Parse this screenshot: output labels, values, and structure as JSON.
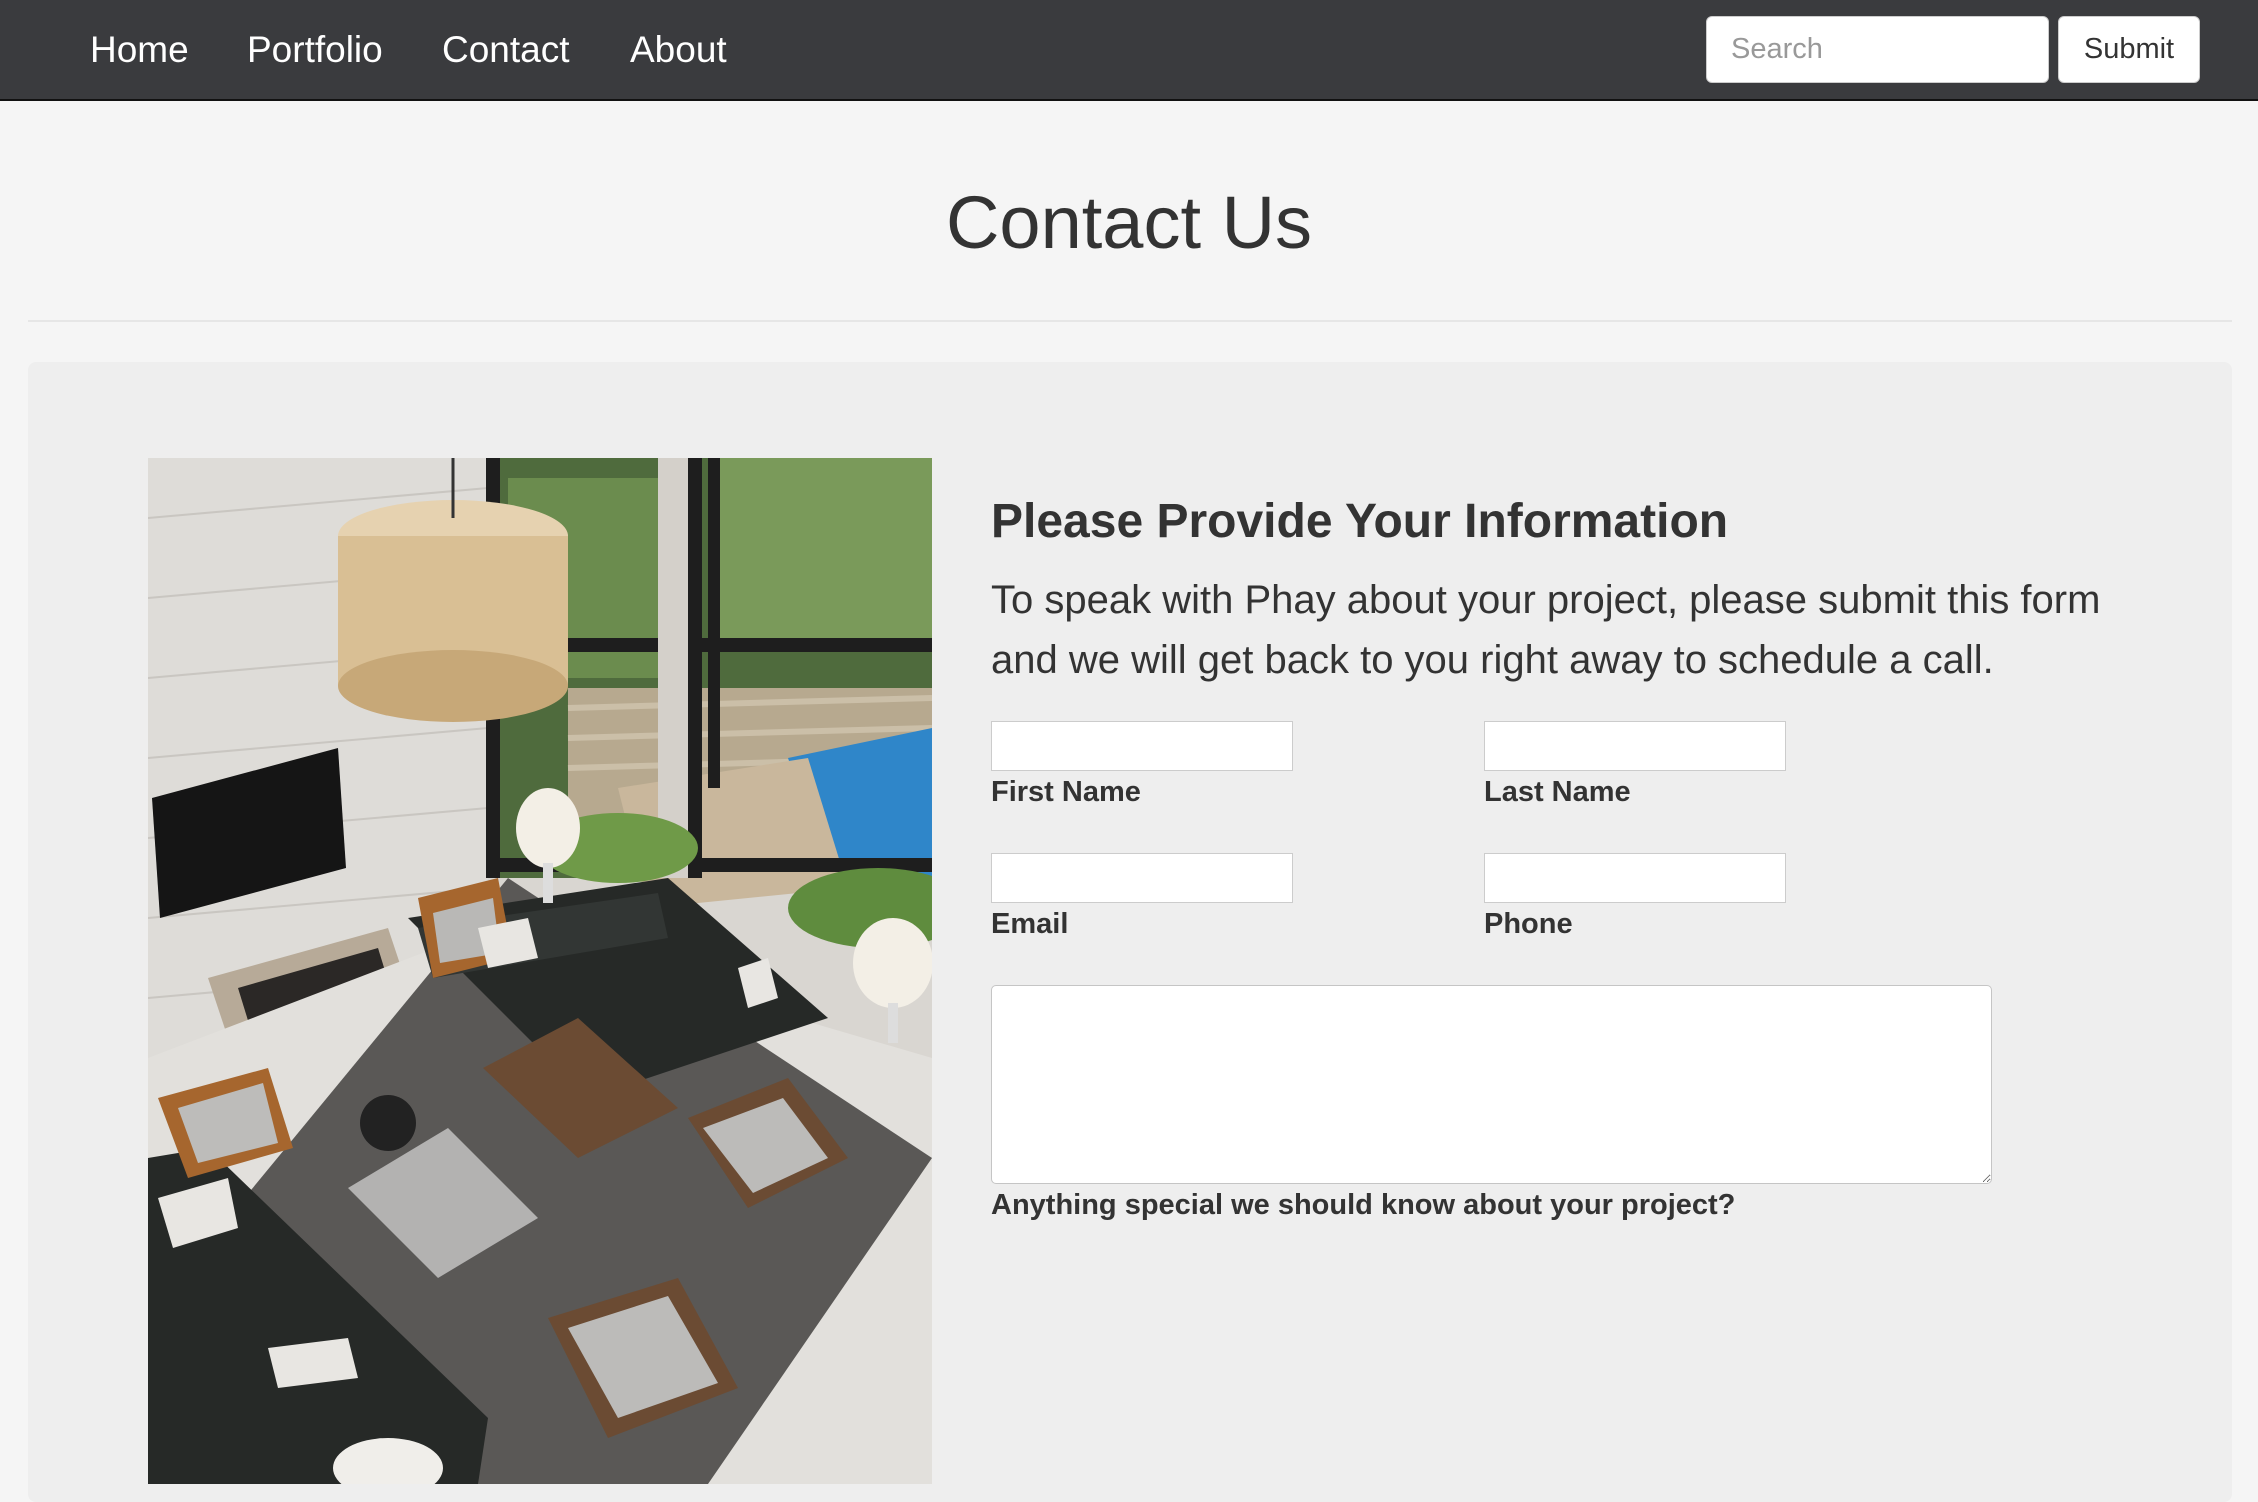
{
  "nav": {
    "links": [
      "Home",
      "Portfolio",
      "Contact",
      "About"
    ],
    "search_placeholder": "Search",
    "submit_label": "Submit"
  },
  "page": {
    "title": "Contact Us"
  },
  "form": {
    "heading": "Please Provide Your Information",
    "intro": "To speak with Phay about your project, please submit this form and we will get back to you right away to schedule a call.",
    "labels": {
      "first_name": "First Name",
      "last_name": "Last Name",
      "email": "Email",
      "phone": "Phone",
      "message": "Anything special we should know about your project?"
    },
    "values": {
      "first_name": "",
      "last_name": "",
      "email": "",
      "phone": "",
      "message": ""
    }
  },
  "colors": {
    "navbar_bg": "#3a3b3e",
    "page_bg": "#f5f5f5",
    "panel_bg": "#eeeeee",
    "text": "#333333"
  },
  "image": {
    "subject": "living-room-photo"
  }
}
